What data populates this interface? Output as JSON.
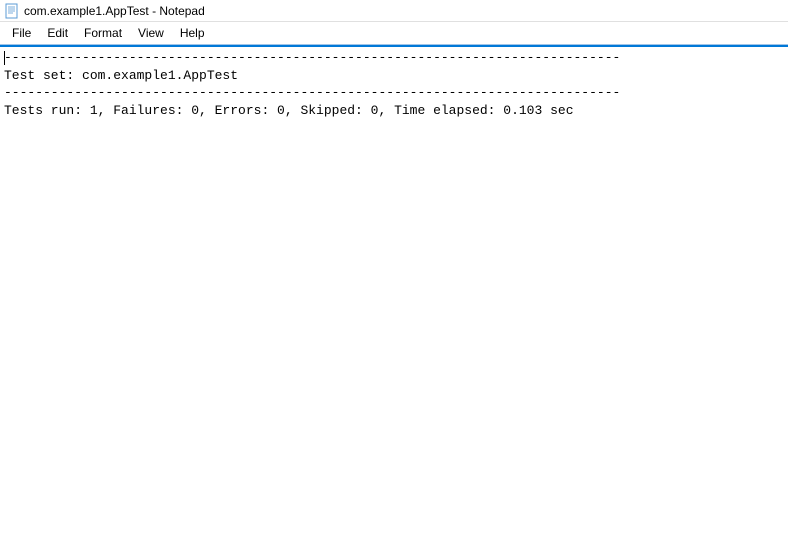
{
  "window": {
    "title": "com.example1.AppTest - Notepad"
  },
  "menu": {
    "file": "File",
    "edit": "Edit",
    "format": "Format",
    "view": "View",
    "help": "Help"
  },
  "editor": {
    "line1": "-------------------------------------------------------------------------------",
    "line2": "Test set: com.example1.AppTest",
    "line3": "-------------------------------------------------------------------------------",
    "line4": "Tests run: 1, Failures: 0, Errors: 0, Skipped: 0, Time elapsed: 0.103 sec"
  }
}
